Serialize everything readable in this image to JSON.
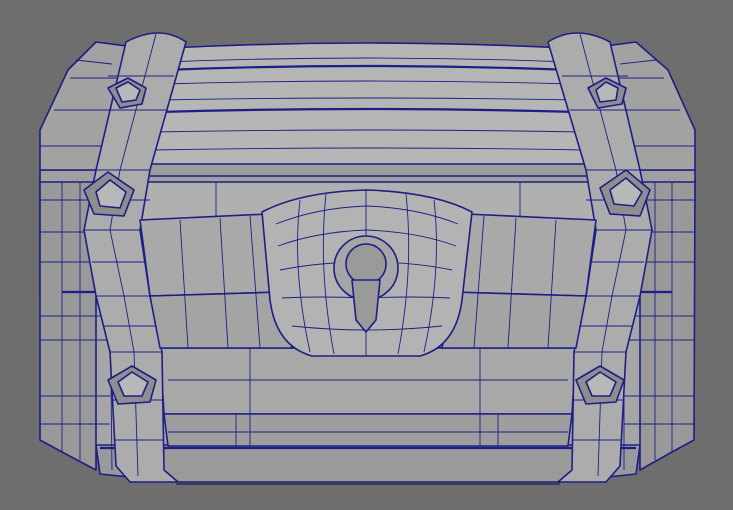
{
  "viewport": {
    "background_color": "#6e6e6e",
    "surface_color": "#a3a3a3",
    "surface_light": "#b4b4b4",
    "surface_dark": "#8c8c8c",
    "wire_color": "#1d1e86",
    "shadow_color": "#3f3f4a"
  },
  "model": {
    "subject": "treasure-chest",
    "display_mode": "wireframe-on-shaded",
    "parts": [
      "lid",
      "base",
      "straps",
      "lock-plate",
      "keyhole",
      "rivets"
    ],
    "rivet_count": 6
  }
}
